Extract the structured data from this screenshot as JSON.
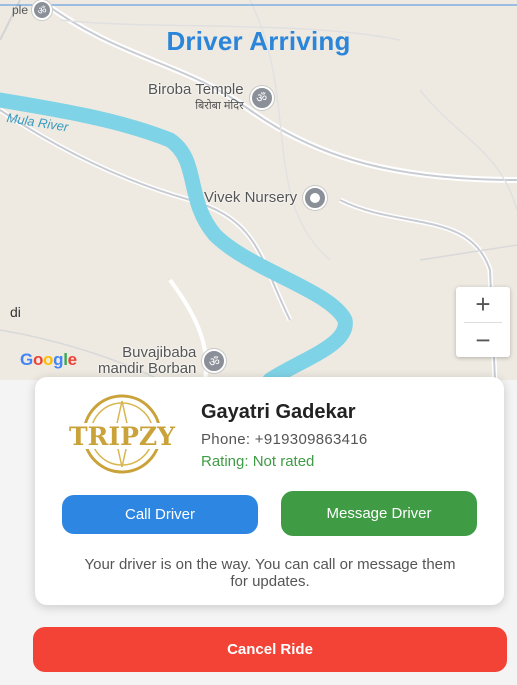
{
  "map": {
    "title": "Driver Arriving",
    "labels": {
      "biroba_temple": "Biroba Temple",
      "biroba_temple_marathi": "बिरोबा मंदिर",
      "river": "Mula River",
      "vivek_nursery": "Vivek Nursery",
      "buvajibaba_line1": "Buvajibaba",
      "buvajibaba_line2": "mandir Borban",
      "left_edge_text": "di",
      "top_left_edge_text": "ple"
    },
    "zoom_in": "+",
    "zoom_out": "−",
    "google_logo": "Google"
  },
  "driver": {
    "name": "Gayatri Gadekar",
    "phone": "Phone: +919309863416",
    "rating": "Rating: Not rated",
    "logo_text": "TRIPZY"
  },
  "actions": {
    "call": "Call Driver",
    "message": "Message Driver",
    "cancel": "Cancel Ride"
  },
  "status_message": "Your driver is on the way. You can call or message them for updates.",
  "colors": {
    "title": "#2b85d8",
    "call_button": "#2d86e2",
    "message_button": "#3f9c45",
    "cancel_button": "#f24336",
    "rating_text": "#3f9c45",
    "river": "#7fd3e6"
  }
}
